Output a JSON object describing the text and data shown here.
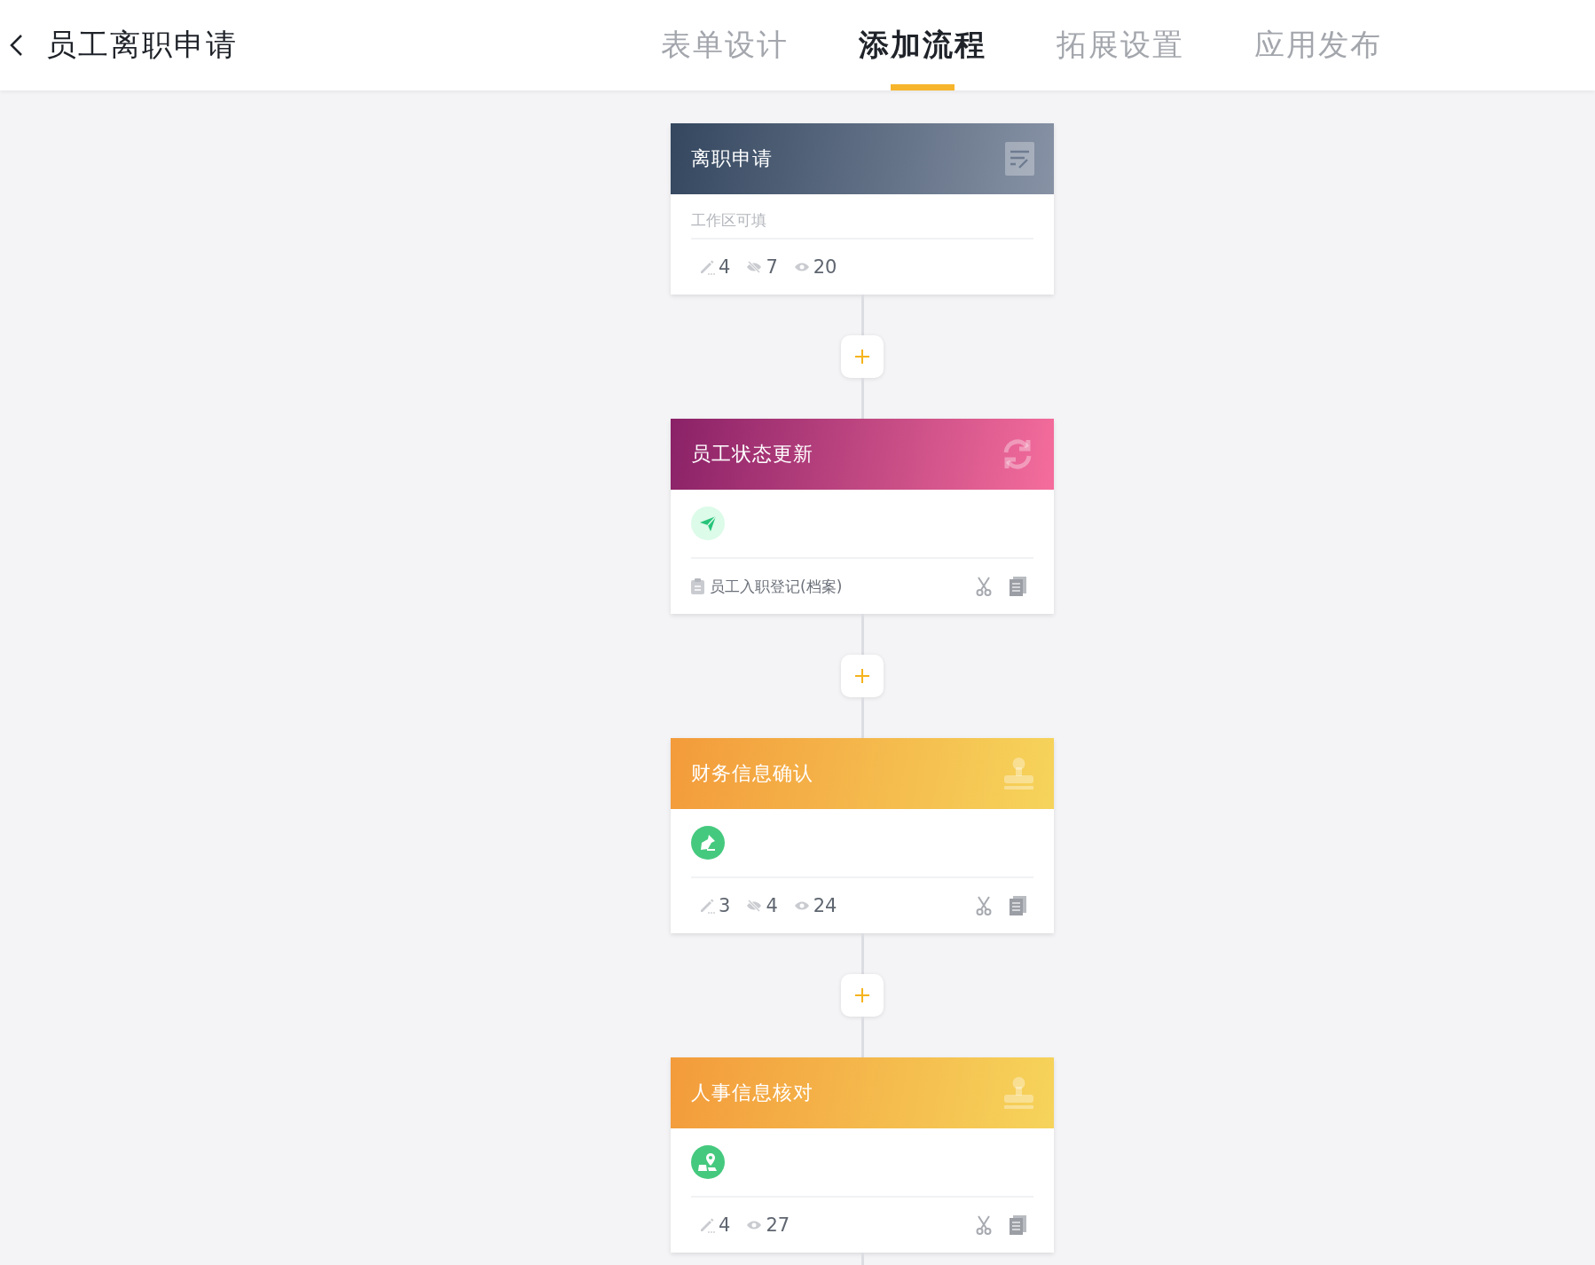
{
  "header": {
    "title": "员工离职申请"
  },
  "tabs": [
    {
      "label": "表单设计",
      "selected": false
    },
    {
      "label": "添加流程",
      "selected": true
    },
    {
      "label": "拓展设置",
      "selected": false
    },
    {
      "label": "应用发布",
      "selected": false
    }
  ],
  "nodes": [
    {
      "kind": "form",
      "title": "离职申请",
      "hint": "工作区可填",
      "stats": [
        {
          "kind": "edit",
          "count": "4"
        },
        {
          "kind": "hidden",
          "count": "7"
        },
        {
          "kind": "visible",
          "count": "20"
        }
      ],
      "tools": false
    },
    {
      "kind": "automation",
      "title": "员工状态更新",
      "badge": {
        "kind": "send"
      },
      "form_link": "员工入职登记(档案)",
      "tools": true
    },
    {
      "kind": "approval",
      "title": "财务信息确认",
      "badge": {
        "kind": "pen"
      },
      "stats": [
        {
          "kind": "edit",
          "count": "3"
        },
        {
          "kind": "hidden",
          "count": "4"
        },
        {
          "kind": "visible",
          "count": "24"
        }
      ],
      "tools": true
    },
    {
      "kind": "approval",
      "title": "人事信息核对",
      "badge": {
        "kind": "map"
      },
      "stats": [
        {
          "kind": "edit",
          "count": "4"
        },
        {
          "kind": "visible",
          "count": "27"
        }
      ],
      "tools": true
    }
  ]
}
